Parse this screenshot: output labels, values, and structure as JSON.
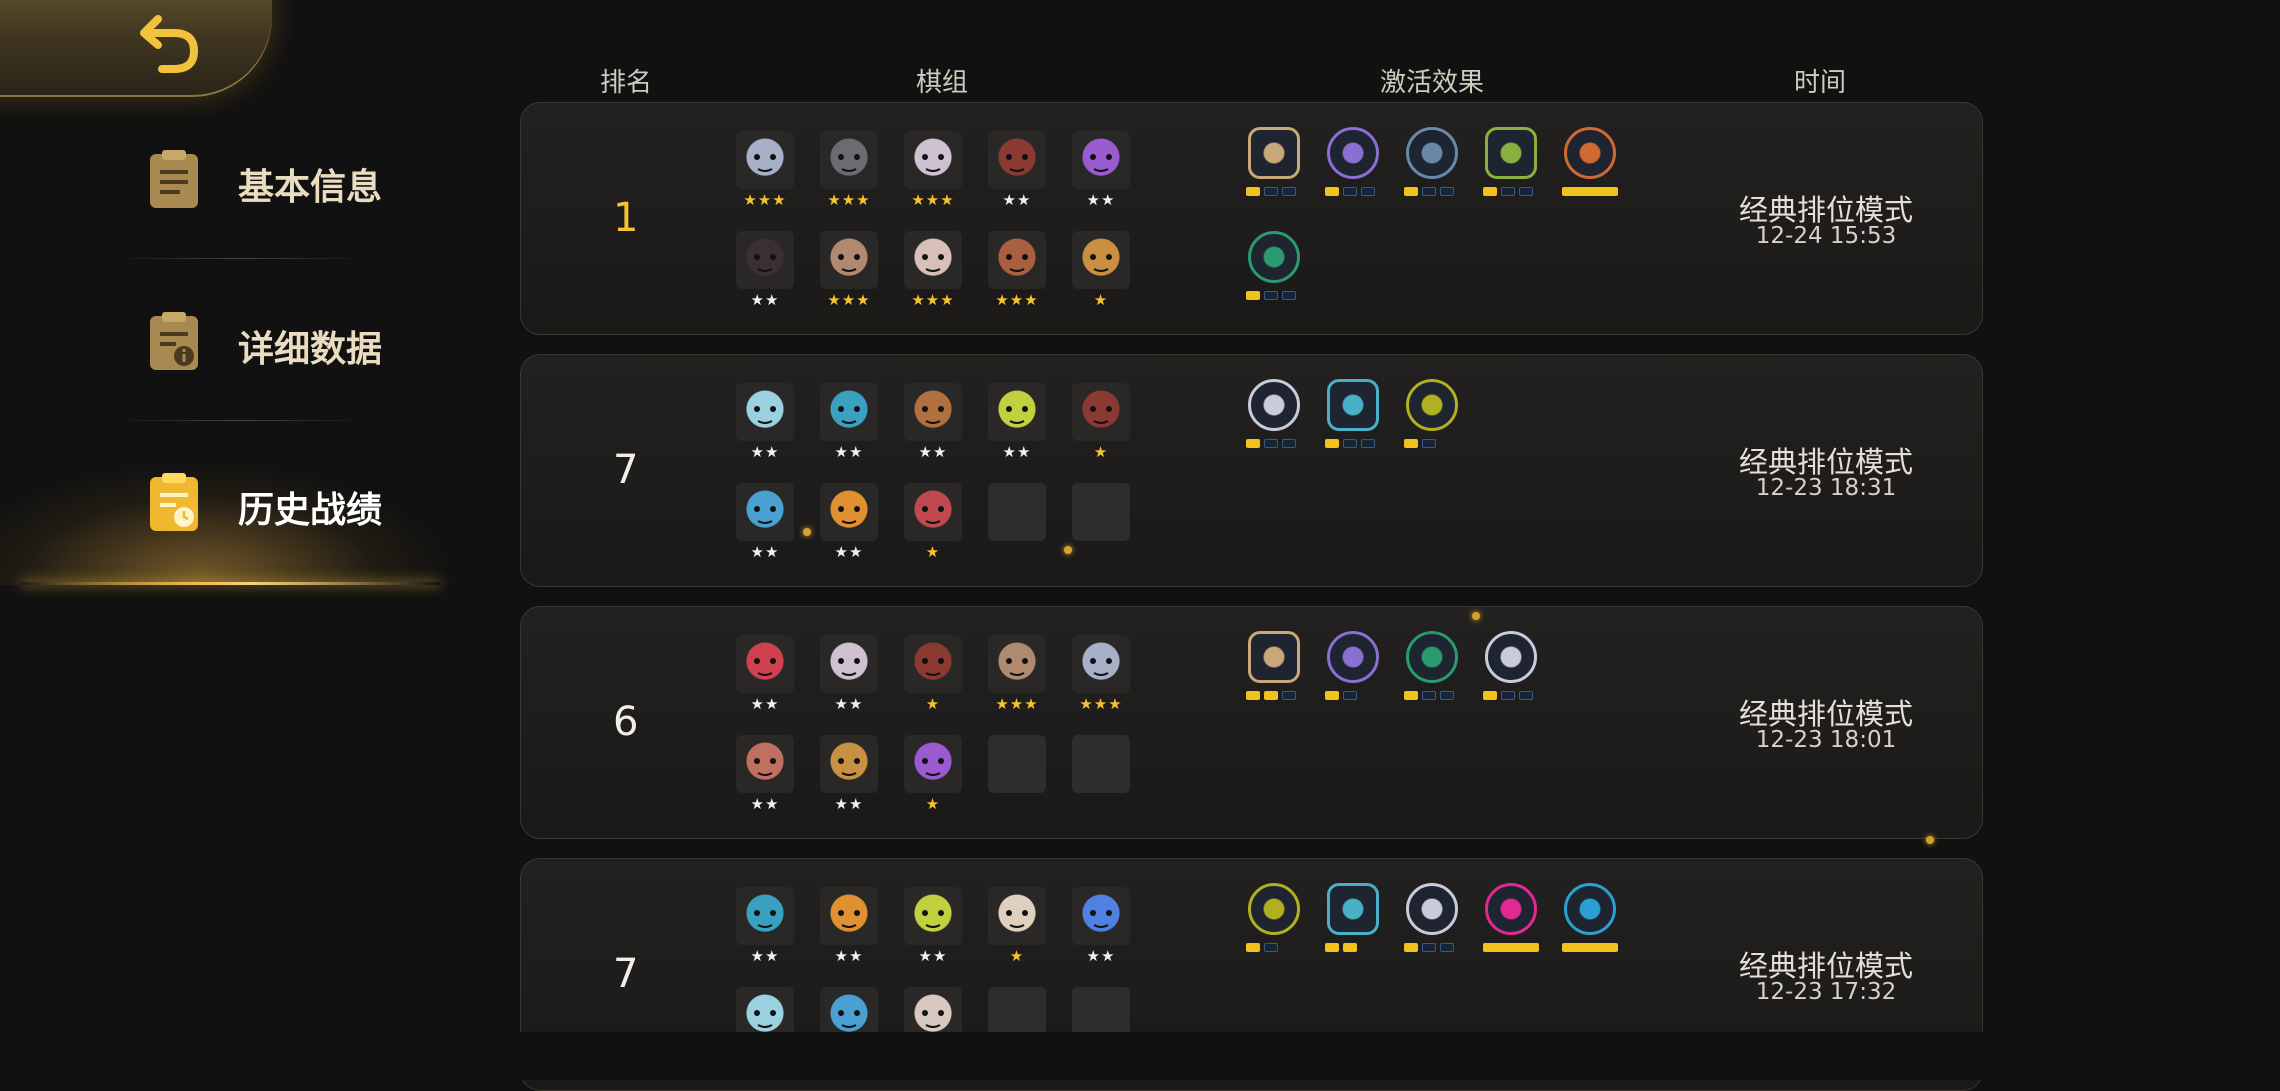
{
  "sidebar": {
    "items": [
      {
        "label": "基本信息",
        "icon": "clipboard-icon",
        "active": false
      },
      {
        "label": "详细数据",
        "icon": "info-document-icon",
        "active": false
      },
      {
        "label": "历史战绩",
        "icon": "history-document-icon",
        "active": true
      }
    ]
  },
  "headers": {
    "rank": "排名",
    "lineup": "棋组",
    "synergy": "激活效果",
    "time": "时间"
  },
  "colors": {
    "gold": "#f4c430",
    "bar_on": "#f2c21c",
    "bar_off": "#15243a",
    "card_bg": "#1e1d1c"
  },
  "matches": [
    {
      "rank": "1",
      "mode": "经典排位模式",
      "date": "12-24 15:53",
      "pieces": [
        {
          "stars": "★★★",
          "gold": true,
          "color": "#a8b0c8"
        },
        {
          "stars": "★★★",
          "gold": true,
          "color": "#6e6a72"
        },
        {
          "stars": "★★★",
          "gold": true,
          "color": "#cfc2d0"
        },
        {
          "stars": "★★",
          "gold": false,
          "color": "#8a3a30"
        },
        {
          "stars": "★★",
          "gold": false,
          "color": "#9a5ad0"
        },
        {
          "stars": "★★",
          "gold": false,
          "color": "#3a3032"
        },
        {
          "stars": "★★★",
          "gold": true,
          "color": "#b08a70"
        },
        {
          "stars": "★★★",
          "gold": true,
          "color": "#d8c0b8"
        },
        {
          "stars": "★★★",
          "gold": true,
          "color": "#a86040"
        },
        {
          "stars": "★",
          "gold": true,
          "color": "#c89040"
        }
      ],
      "synergies": [
        {
          "icon": "axe-icon",
          "color": "#c8a878",
          "shape": "hex",
          "on": 1,
          "total": 3
        },
        {
          "icon": "fishbone-icon",
          "color": "#8a70d0",
          "shape": "circle",
          "on": 1,
          "total": 3
        },
        {
          "icon": "scatter-icon",
          "color": "#6a88a8",
          "shape": "circle",
          "on": 1,
          "total": 3
        },
        {
          "icon": "bow-icon",
          "color": "#8ab040",
          "shape": "hex",
          "on": 1,
          "total": 3
        },
        {
          "icon": "ogre-icon",
          "color": "#d06a30",
          "shape": "circle",
          "on": 1,
          "total": 1
        },
        {
          "icon": "paw-icon",
          "color": "#2a9a70",
          "shape": "circle",
          "on": 1,
          "total": 3
        }
      ]
    },
    {
      "rank": "7",
      "mode": "经典排位模式",
      "date": "12-23 18:31",
      "pieces": [
        {
          "stars": "★★",
          "gold": false,
          "color": "#9ad0e0"
        },
        {
          "stars": "★★",
          "gold": false,
          "color": "#3aa0c0"
        },
        {
          "stars": "★★",
          "gold": false,
          "color": "#b07040"
        },
        {
          "stars": "★★",
          "gold": false,
          "color": "#c0d040"
        },
        {
          "stars": "★",
          "gold": true,
          "color": "#8a3a30"
        },
        {
          "stars": "★★",
          "gold": false,
          "color": "#4aa0d0"
        },
        {
          "stars": "★★",
          "gold": false,
          "color": "#e09030"
        },
        {
          "stars": "★",
          "gold": true,
          "color": "#c04850"
        },
        {
          "stars": "",
          "gold": false,
          "color": "empty"
        },
        {
          "stars": "",
          "gold": false,
          "color": "empty"
        }
      ],
      "synergies": [
        {
          "icon": "bed-icon",
          "color": "#c8ccd8",
          "shape": "circle",
          "on": 1,
          "total": 3
        },
        {
          "icon": "question-icon",
          "color": "#4ab0c8",
          "shape": "hex",
          "on": 1,
          "total": 3
        },
        {
          "icon": "cubes-icon",
          "color": "#b0b020",
          "shape": "circle",
          "on": 1,
          "total": 2
        }
      ]
    },
    {
      "rank": "6",
      "mode": "经典排位模式",
      "date": "12-23 18:01",
      "pieces": [
        {
          "stars": "★★",
          "gold": false,
          "color": "#d04050"
        },
        {
          "stars": "★★",
          "gold": false,
          "color": "#cfc2d0"
        },
        {
          "stars": "★",
          "gold": true,
          "color": "#8a3a30"
        },
        {
          "stars": "★★★",
          "gold": true,
          "color": "#b08a70"
        },
        {
          "stars": "★★★",
          "gold": true,
          "color": "#a8b0c8"
        },
        {
          "stars": "★★",
          "gold": false,
          "color": "#c07060"
        },
        {
          "stars": "★★",
          "gold": false,
          "color": "#c89040"
        },
        {
          "stars": "★",
          "gold": true,
          "color": "#9a5ad0"
        },
        {
          "stars": "",
          "gold": false,
          "color": "empty"
        },
        {
          "stars": "",
          "gold": false,
          "color": "empty"
        }
      ],
      "synergies": [
        {
          "icon": "axe-icon",
          "color": "#c8a878",
          "shape": "hex",
          "on": 2,
          "total": 3
        },
        {
          "icon": "fishbone-icon",
          "color": "#8a70d0",
          "shape": "circle",
          "on": 1,
          "total": 2
        },
        {
          "icon": "paw-icon",
          "color": "#2a9a70",
          "shape": "circle",
          "on": 1,
          "total": 3
        },
        {
          "icon": "bed-icon",
          "color": "#c8ccd8",
          "shape": "circle",
          "on": 1,
          "total": 3
        }
      ]
    },
    {
      "rank": "7",
      "mode": "经典排位模式",
      "date": "12-23 17:32",
      "pieces": [
        {
          "stars": "★★",
          "gold": false,
          "color": "#3aa0c0"
        },
        {
          "stars": "★★",
          "gold": false,
          "color": "#e09030"
        },
        {
          "stars": "★★",
          "gold": false,
          "color": "#c0d040"
        },
        {
          "stars": "★",
          "gold": true,
          "color": "#e0d0c0"
        },
        {
          "stars": "★★",
          "gold": false,
          "color": "#5080e0"
        },
        {
          "stars": "",
          "gold": false,
          "color": "#9ad0e0"
        },
        {
          "stars": "",
          "gold": false,
          "color": "#4aa0d0"
        },
        {
          "stars": "",
          "gold": false,
          "color": "#d8c8c0"
        },
        {
          "stars": "",
          "gold": false,
          "color": "empty"
        },
        {
          "stars": "",
          "gold": false,
          "color": "empty"
        }
      ],
      "synergies": [
        {
          "icon": "cubes-icon",
          "color": "#b0b020",
          "shape": "circle",
          "on": 1,
          "total": 2
        },
        {
          "icon": "question-icon",
          "color": "#4ab0c8",
          "shape": "hex",
          "on": 2,
          "total": 2
        },
        {
          "icon": "bed-icon",
          "color": "#c8ccd8",
          "shape": "circle",
          "on": 1,
          "total": 3
        },
        {
          "icon": "bat-icon",
          "color": "#e02a90",
          "shape": "circle",
          "on": 1,
          "total": 1
        },
        {
          "icon": "demon-icon",
          "color": "#2aa0d0",
          "shape": "circle",
          "on": 1,
          "total": 1
        }
      ]
    }
  ]
}
